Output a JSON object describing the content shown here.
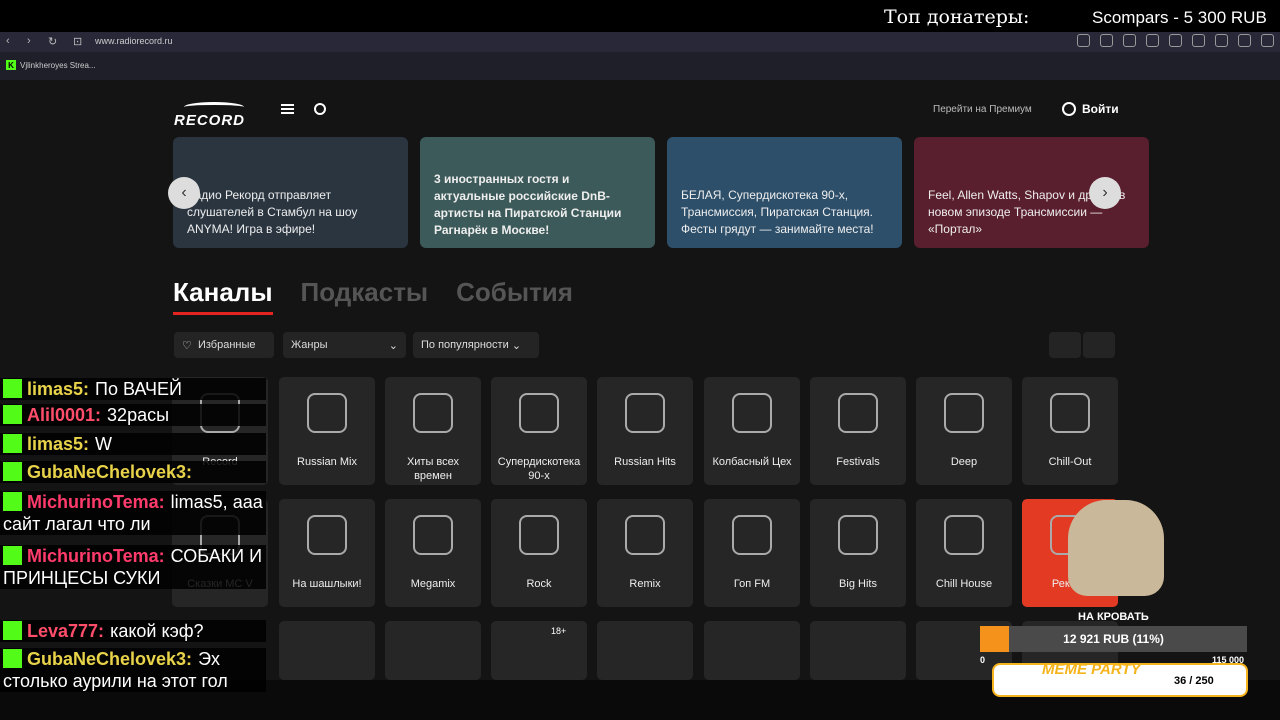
{
  "stream_overlay": {
    "top_donors_label": "Топ донатеры:",
    "top_donor": "Scompars - 5 300 RUB"
  },
  "browser": {
    "url": "www.radiorecord.ru",
    "bookmark": "Vjlinkheroyes Strea..."
  },
  "header": {
    "premium_label": "Перейти на Премиум",
    "login_label": "Войти",
    "logo_text": "RECORD"
  },
  "carousel": [
    {
      "text": "Радио Рекорд отправляет слушателей в Стамбул на шоу ANYMA! Игра в эфире!",
      "bg": "#2a3540"
    },
    {
      "text": "3 иностранных гостя и актуальные российские DnB-артисты на Пиратской Станции Рагнарёк в Москве!",
      "bg": "#3d5a5a"
    },
    {
      "text": "БЕЛАЯ, Супердискотека 90-х, Трансмиссия, Пиратская Станция. Фесты грядут — занимайте места!",
      "bg": "#2d4f6a"
    },
    {
      "text": "Feel, Allen Watts, Shapov и другие в новом эпизоде Трансмиссии — «Портал»",
      "bg": "#5a1f2e"
    }
  ],
  "tabs": [
    {
      "label": "Каналы",
      "active": true
    },
    {
      "label": "Подкасты",
      "active": false
    },
    {
      "label": "События",
      "active": false
    }
  ],
  "filters": {
    "favorites": "Избранные",
    "genres": "Жанры",
    "sort": "По популярности"
  },
  "channels_row1": [
    "Record",
    "Russian Mix",
    "Хиты всех времен",
    "Супердискотека 90-х",
    "Russian Hits",
    "Колбасный Цех",
    "Festivals",
    "Deep",
    "Chill-Out"
  ],
  "channels_row2": [
    "Сказки MC V",
    "На шашлыки!",
    "Megamix",
    "Rock",
    "Remix",
    "Гоп FM",
    "Big Hits",
    "Chill House",
    "Рекорд"
  ],
  "badge_18": "18+",
  "chat": [
    {
      "user": "limas5:",
      "msg": "По ВАЧЕЙ",
      "color": "#e8d24a"
    },
    {
      "user": "Alil0001:",
      "msg": "32расы",
      "color": "#ff4d6a"
    },
    {
      "user": "limas5:",
      "msg": "W",
      "color": "#e8d24a"
    },
    {
      "user": "GubaNeChelovek3:",
      "msg": "",
      "color": "#e8d24a"
    },
    {
      "user": "MichurinoTema:",
      "msg": "limas5, ааа сайт лагал что ли",
      "color": "#ff3b6b"
    },
    {
      "user": "MichurinoTema:",
      "msg": "СОБАКИ И ПРИНЦЕСЫ СУКИ",
      "color": "#ff3b6b"
    },
    {
      "user": "Leva777:",
      "msg": "какой кэф?",
      "color": "#ff4d6a"
    },
    {
      "user": "GubaNeChelovek3:",
      "msg": "Эх столько аурили на этот гол",
      "color": "#e8d24a"
    }
  ],
  "goal": {
    "title": "НА КРОВАТЬ",
    "text": "12 921 RUB (11%)",
    "progress": 0.11,
    "min": "0",
    "max": "115 000"
  },
  "meme": {
    "label": "MEME PARTY",
    "count": "36 / 250"
  }
}
